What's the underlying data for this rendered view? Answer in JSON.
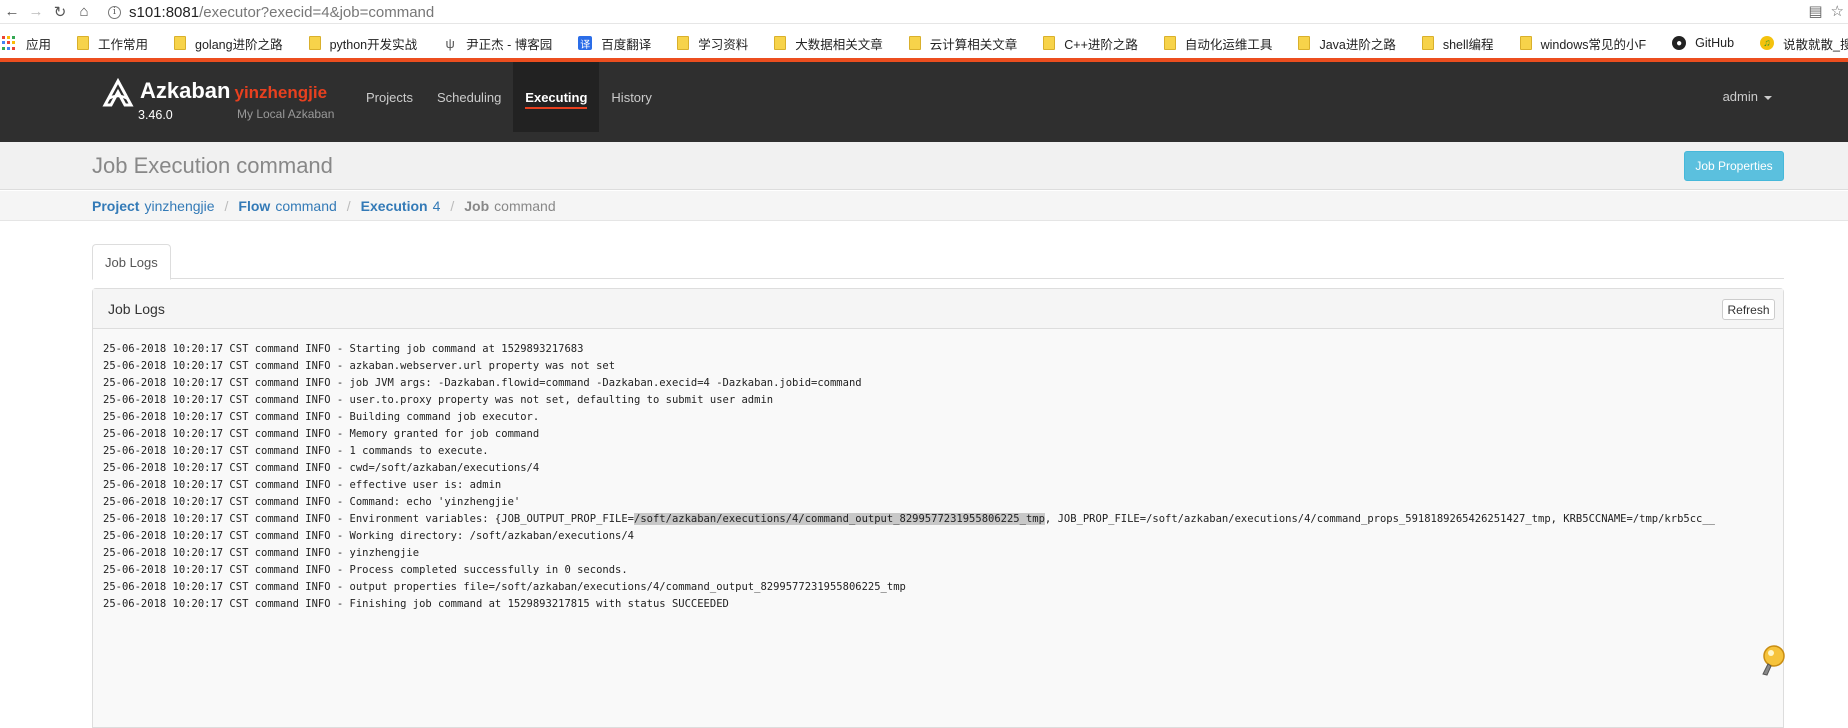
{
  "browser": {
    "url_host": "s101:8081",
    "url_path": "/executor?execid=4&job=command",
    "bookmarks": [
      {
        "label": "应用",
        "icon": "apps-grid-icon"
      },
      {
        "label": "工作常用",
        "icon": "folder-icon"
      },
      {
        "label": "golang进阶之路",
        "icon": "folder-icon"
      },
      {
        "label": "python开发实战",
        "icon": "folder-icon"
      },
      {
        "label": "尹正杰 - 博客园",
        "icon": "blog-icon"
      },
      {
        "label": "百度翻译",
        "icon": "translate-icon"
      },
      {
        "label": "学习资料",
        "icon": "folder-icon"
      },
      {
        "label": "大数据相关文章",
        "icon": "folder-icon"
      },
      {
        "label": "云计算相关文章",
        "icon": "folder-icon"
      },
      {
        "label": "C++进阶之路",
        "icon": "folder-icon"
      },
      {
        "label": "自动化运维工具",
        "icon": "folder-icon"
      },
      {
        "label": "Java进阶之路",
        "icon": "folder-icon"
      },
      {
        "label": "shell编程",
        "icon": "folder-icon"
      },
      {
        "label": "windows常见的小F",
        "icon": "folder-icon"
      },
      {
        "label": "GitHub",
        "icon": "github-icon"
      },
      {
        "label": "说散就散_搜索 QQ[",
        "icon": "qq-music-icon"
      }
    ]
  },
  "navbar": {
    "brand": "Azkaban",
    "user": "yinzhengjie",
    "version": "3.46.0",
    "subtitle": "My Local Azkaban",
    "links": [
      "Projects",
      "Scheduling",
      "Executing",
      "History"
    ],
    "active": "Executing",
    "account": "admin"
  },
  "header": {
    "title": "Job Execution command",
    "props_button": "Job Properties"
  },
  "breadcrumb": [
    {
      "key": "Project",
      "value": "yinzhengjie"
    },
    {
      "key": "Flow",
      "value": "command"
    },
    {
      "key": "Execution",
      "value": "4"
    },
    {
      "key": "Job",
      "value": "command"
    }
  ],
  "tabs": {
    "active": "Job Logs"
  },
  "panel": {
    "title": "Job Logs",
    "refresh": "Refresh"
  },
  "log": {
    "prefix": "25-06-2018 10:20:17 CST command INFO - ",
    "lines": [
      "Starting job command at 1529893217683",
      "azkaban.webserver.url property was not set",
      "job JVM args: -Dazkaban.flowid=command -Dazkaban.execid=4 -Dazkaban.jobid=command",
      "user.to.proxy property was not set, defaulting to submit user admin",
      "Building command job executor.",
      "Memory granted for job command",
      "1 commands to execute.",
      "cwd=/soft/azkaban/executions/4",
      "effective user is: admin",
      "Command: echo 'yinzhengjie'",
      "Environment variables: {JOB_OUTPUT_PROP_FILE=/soft/azkaban/executions/4/command_output_8299577231955806225_tmp, JOB_PROP_FILE=/soft/azkaban/executions/4/command_props_5918189265426251427_tmp, KRB5CCNAME=/tmp/krb5cc__",
      "Working directory: /soft/azkaban/executions/4",
      "yinzhengjie",
      "Process completed successfully in 0 seconds.",
      "output properties file=/soft/azkaban/executions/4/command_output_8299577231955806225_tmp",
      "Finishing job command at 1529893217815 with status SUCCEEDED"
    ],
    "highlight": {
      "line": 10,
      "before": "Environment variables: {JOB_OUTPUT_PROP_FILE=",
      "selected": "/soft/azkaban/executions/4/command_output_8299577231955806225_tmp",
      "after": ", JOB_PROP_FILE=/soft/azkaban/executions/4/command_props_5918189265426251427_tmp, KRB5CCNAME=/tmp/krb5cc__"
    }
  },
  "colors": {
    "accent": "#e8401f",
    "navbar": "#2f2f2f",
    "link": "#337ab7",
    "info_button": "#5bc0de"
  }
}
